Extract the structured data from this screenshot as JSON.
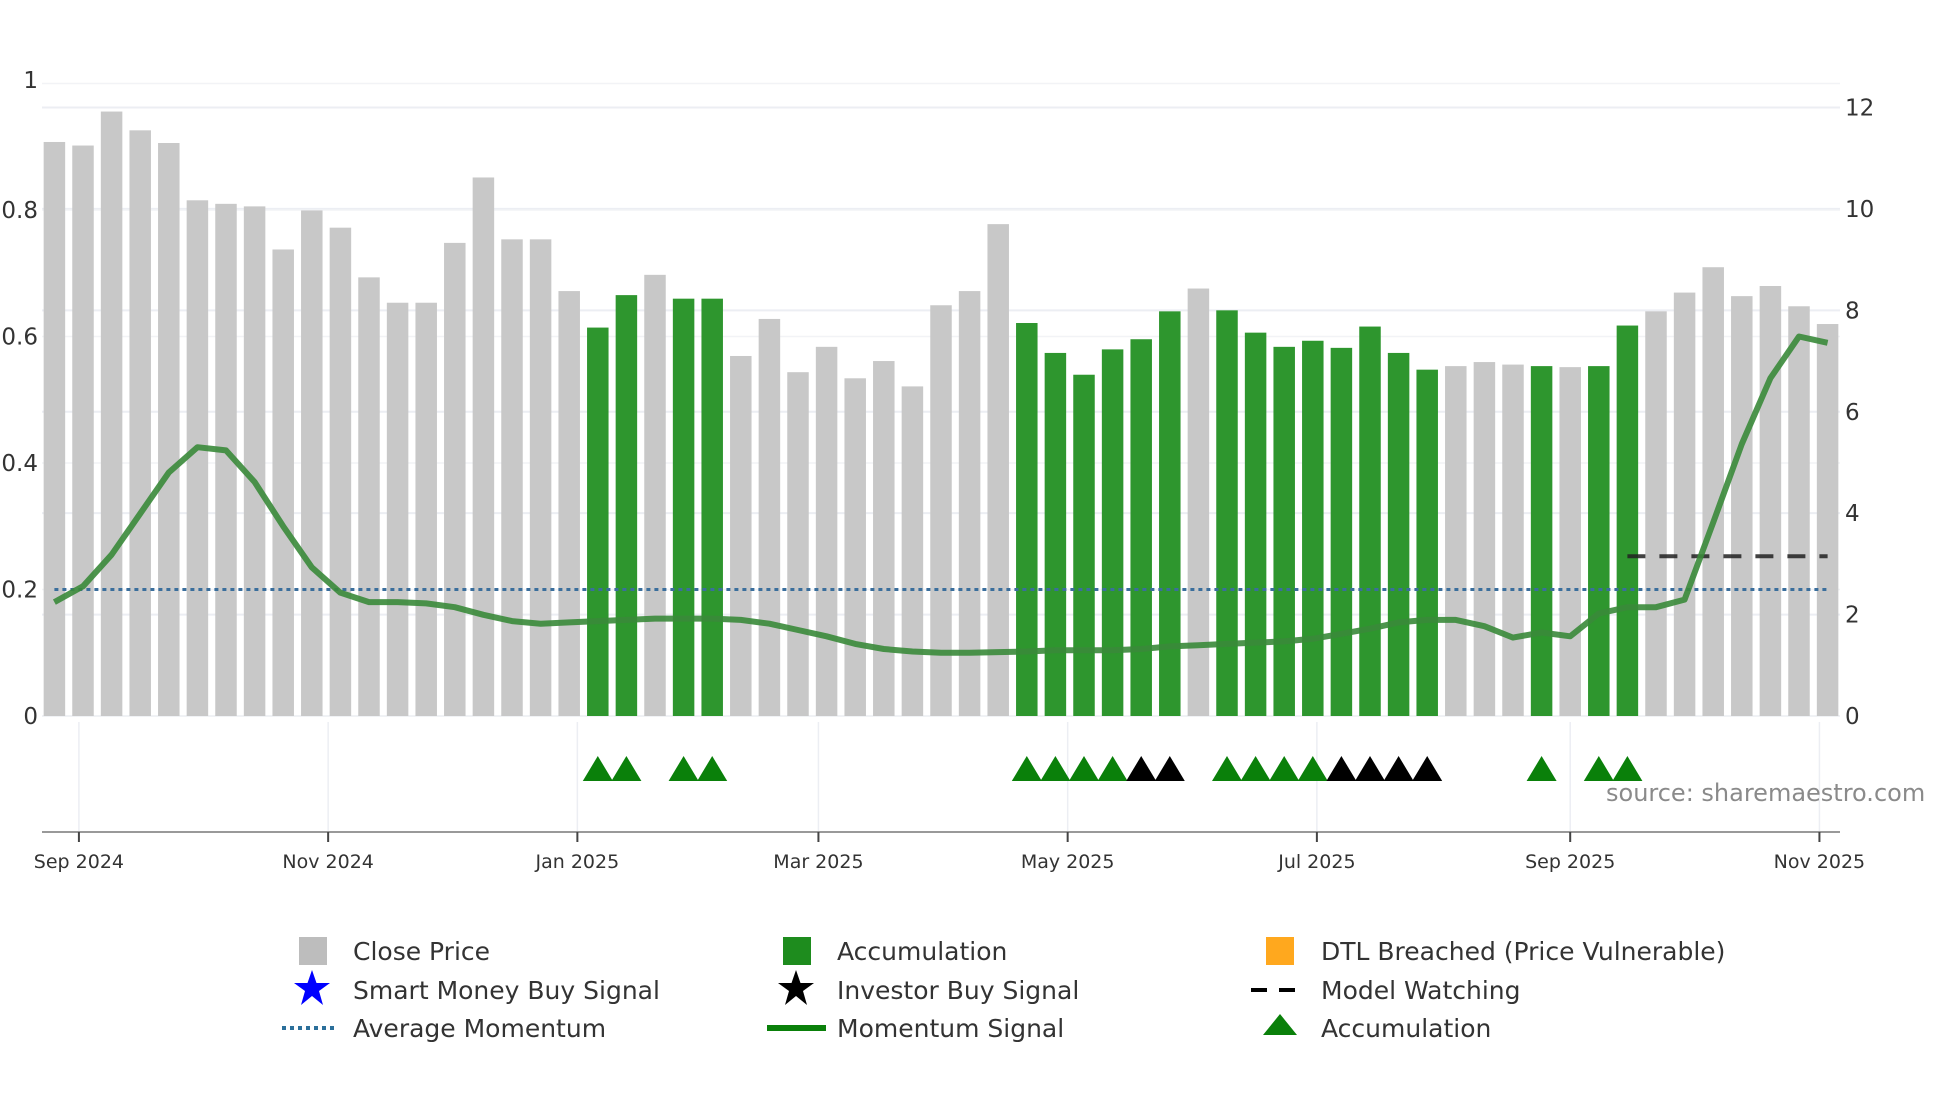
{
  "chart_data": {
    "type": "bar",
    "title": "",
    "first_bar_date": "2024-08-26",
    "interval_days": 7,
    "left_axis": {
      "ylim": [
        0,
        1
      ],
      "ticks": [
        "0",
        "0.2",
        "0.4",
        "0.6",
        "0.8",
        "1"
      ],
      "tick_values": [
        0,
        0.2,
        0.4,
        0.6,
        0.8,
        1
      ]
    },
    "right_axis": {
      "ylim": [
        0,
        12
      ],
      "ticks": [
        "0",
        "2",
        "4",
        "6",
        "8",
        "10",
        "12"
      ],
      "tick_values": [
        0,
        2,
        4,
        6,
        8,
        10,
        12
      ]
    },
    "x_ticks": [
      {
        "label": "Sep 2024",
        "date": "2024-09-01"
      },
      {
        "label": "Nov 2024",
        "date": "2024-11-01"
      },
      {
        "label": "Jan 2025",
        "date": "2025-01-01"
      },
      {
        "label": "Mar 2025",
        "date": "2025-03-01"
      },
      {
        "label": "May 2025",
        "date": "2025-05-01"
      },
      {
        "label": "Jul 2025",
        "date": "2025-07-01"
      },
      {
        "label": "Sep 2025",
        "date": "2025-09-01"
      },
      {
        "label": "Nov 2025",
        "date": "2025-11-01"
      }
    ],
    "close_price": [
      11.32,
      11.25,
      11.92,
      11.55,
      11.3,
      10.17,
      10.1,
      10.05,
      9.2,
      9.97,
      9.63,
      8.65,
      8.15,
      8.15,
      9.33,
      10.62,
      9.4,
      9.4,
      8.38,
      7.66,
      8.3,
      8.7,
      8.23,
      8.23,
      7.1,
      7.83,
      6.78,
      7.28,
      6.66,
      7.0,
      6.5,
      8.1,
      8.38,
      9.7,
      7.75,
      7.16,
      6.73,
      7.23,
      7.43,
      7.98,
      8.43,
      8.0,
      7.56,
      7.28,
      7.4,
      7.26,
      7.68,
      7.16,
      6.83,
      6.9,
      6.98,
      6.93,
      6.9,
      6.88,
      6.9,
      7.7,
      7.98,
      8.35,
      8.85,
      8.28,
      8.48,
      8.08,
      7.73
    ],
    "accumulation_bars": [
      20,
      21,
      23,
      24,
      35,
      36,
      37,
      38,
      39,
      40,
      42,
      43,
      44,
      45,
      46,
      47,
      48,
      49,
      53,
      55,
      56
    ],
    "momentum_signal": [
      0.18,
      0.205,
      0.255,
      0.32,
      0.385,
      0.425,
      0.42,
      0.37,
      0.3,
      0.235,
      0.195,
      0.18,
      0.18,
      0.178,
      0.172,
      0.16,
      0.15,
      0.146,
      0.148,
      0.15,
      0.152,
      0.154,
      0.154,
      0.154,
      0.152,
      0.146,
      0.136,
      0.126,
      0.114,
      0.106,
      0.102,
      0.1,
      0.1,
      0.101,
      0.102,
      0.104,
      0.104,
      0.104,
      0.106,
      0.11,
      0.112,
      0.114,
      0.116,
      0.118,
      0.122,
      0.13,
      0.138,
      0.148,
      0.152,
      0.152,
      0.142,
      0.124,
      0.132,
      0.126,
      0.162,
      0.172,
      0.172,
      0.184,
      0.306,
      0.43,
      0.534,
      0.6,
      0.59
    ],
    "average_momentum": 0.2,
    "model_watching": {
      "value_right_axis": 3.15,
      "from_bar": 56,
      "to_bar": 63
    },
    "accumulation_markers": [
      20,
      21,
      23,
      24,
      35,
      36,
      37,
      38,
      42,
      43,
      44,
      45,
      53,
      55,
      56
    ],
    "investor_markers": [
      39,
      40,
      46,
      47,
      48,
      49
    ],
    "colors": {
      "close": "#c8c8c8",
      "accumulation": "#2e962e",
      "momentum": "#3a8a3a",
      "avg": "#3a6e9c",
      "watch": "#222222",
      "dtl": "#ffa81e",
      "smart": "#0000ff",
      "investor": "#000000",
      "triangle": "#0a800a"
    },
    "legend": {
      "close_price": "Close Price",
      "accumulation": "Accumulation",
      "dtl": "DTL Breached (Price Vulnerable)",
      "smart_money": "Smart Money Buy Signal",
      "investor": "Investor Buy Signal",
      "model_watching": "Model Watching",
      "avg_momentum": "Average Momentum",
      "momentum": "Momentum Signal",
      "accumulation_marker": "Accumulation"
    },
    "source": "source: sharemaestro.com"
  }
}
